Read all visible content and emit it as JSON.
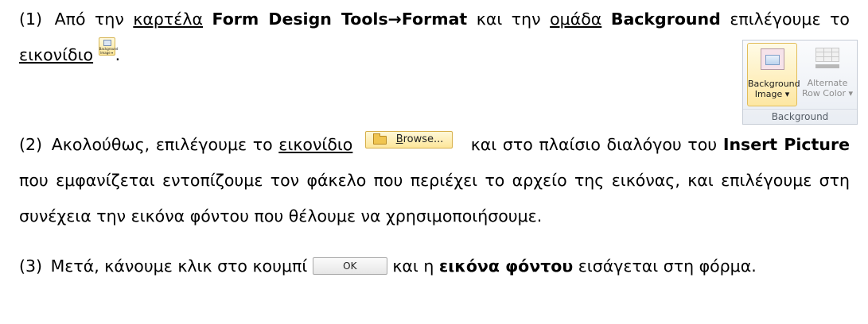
{
  "step1": {
    "number": "(1)",
    "t1": "Από την ",
    "tab_word": "καρτέλα",
    "t2": " ",
    "tab_name": "Form Design Tools",
    "arrow": "→",
    "format_tab": "Format",
    "t3": " και την ",
    "group_word": "ομάδα",
    "t4": " ",
    "group_name": "Background",
    "t5": " επιλέγουμε το ",
    "icon_word": "εικονίδιο",
    "t6": ".",
    "mini_icon": {
      "name": "background-image-icon",
      "line1": "Background",
      "line2": "Image ▾"
    }
  },
  "step2": {
    "number": "(2)",
    "t1": "Ακολούθως, επιλέγουμε το ",
    "icon_word": "εικονίδιο",
    "t2": " και στο πλαίσιο διαλόγου του ",
    "dialog_name": "Insert Picture",
    "t3": " που εμφανίζεται εντοπίζουμε τον φάκελο που περιέχει το αρχείο της εικόνας, και επιλέγουμε στη συνέχεια την εικόνα φόντου που θέλουμε να χρησιμοποιήσουμε.",
    "browse_button": {
      "accel": "B",
      "rest": "rowse...",
      "icon": "folder-icon"
    }
  },
  "step3": {
    "number": "(3)",
    "t1": "Μετά, κάνουμε κλικ στο κουμπί ",
    "ok_label": "OK",
    "t2": " και η ",
    "bold_phrase": "εικόνα φόντου",
    "t3": " εισάγεται στη φόρμα."
  },
  "ribbon": {
    "btn_background_image": {
      "line1": "Background",
      "line2": "Image ▾",
      "icon": "background-image-icon"
    },
    "btn_alternate_row_color": {
      "line1": "Alternate",
      "line2": "Row Color ▾",
      "icon": "alternate-row-color-icon",
      "enabled": false
    },
    "group_label": "Background"
  },
  "colors": {
    "highlight_button": "#fde7a3",
    "disabled_text": "#8e8e8e"
  }
}
